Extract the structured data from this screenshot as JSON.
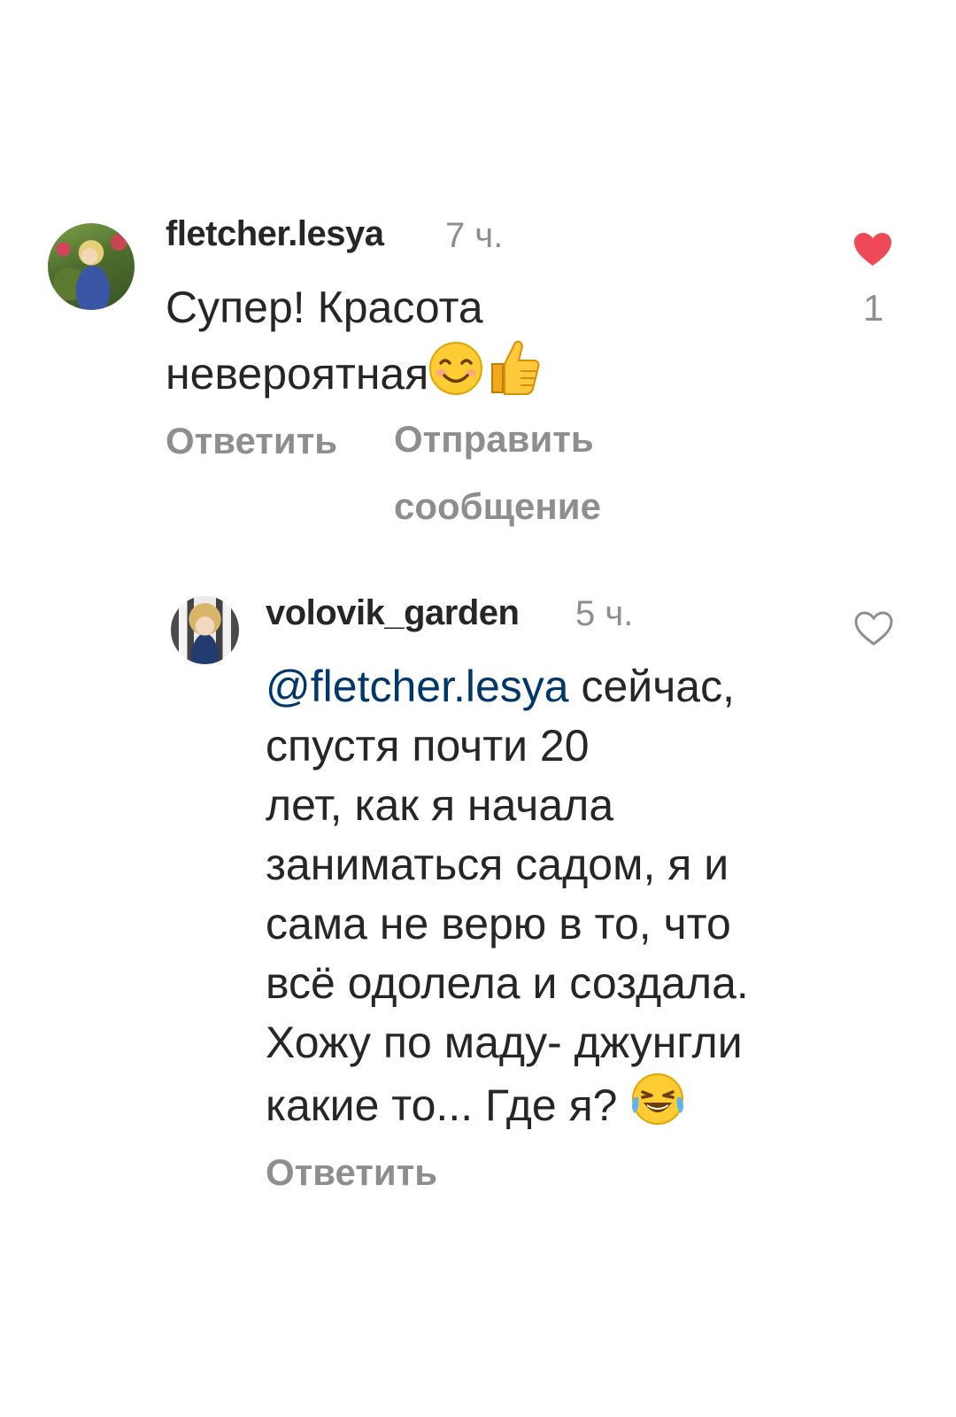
{
  "comments": [
    {
      "username": "fletcher.lesya",
      "time": "7 ч.",
      "text_line1": "Супер! Красота",
      "text_line2": "невероятная",
      "emojis": [
        "smiling-face-emoji",
        "thumbs-up-emoji"
      ],
      "actions": {
        "reply": "Ответить",
        "send_line1": "Отправить",
        "send_line2": "сообщение"
      },
      "liked": true,
      "like_count": "1",
      "like_icon": "heart-filled-icon",
      "like_color": "#ed4956"
    },
    {
      "username": "volovik_garden",
      "time": "5 ч.",
      "mention": "@fletcher.lesya",
      "text_line1_rest": " сейчас,",
      "text_lines": [
        "спустя почти 20",
        "лет, как я начала",
        "заниматься садом, я и",
        "сама не верю в то, что",
        "всё одолела и создала.",
        "Хожу по маду- джунгли"
      ],
      "text_last": "какие то... Где я? ",
      "emojis": [
        "tears-of-joy-emoji"
      ],
      "actions": {
        "reply": "Ответить"
      },
      "liked": false,
      "like_icon": "heart-outline-icon",
      "mention_color": "#00376b"
    }
  ]
}
